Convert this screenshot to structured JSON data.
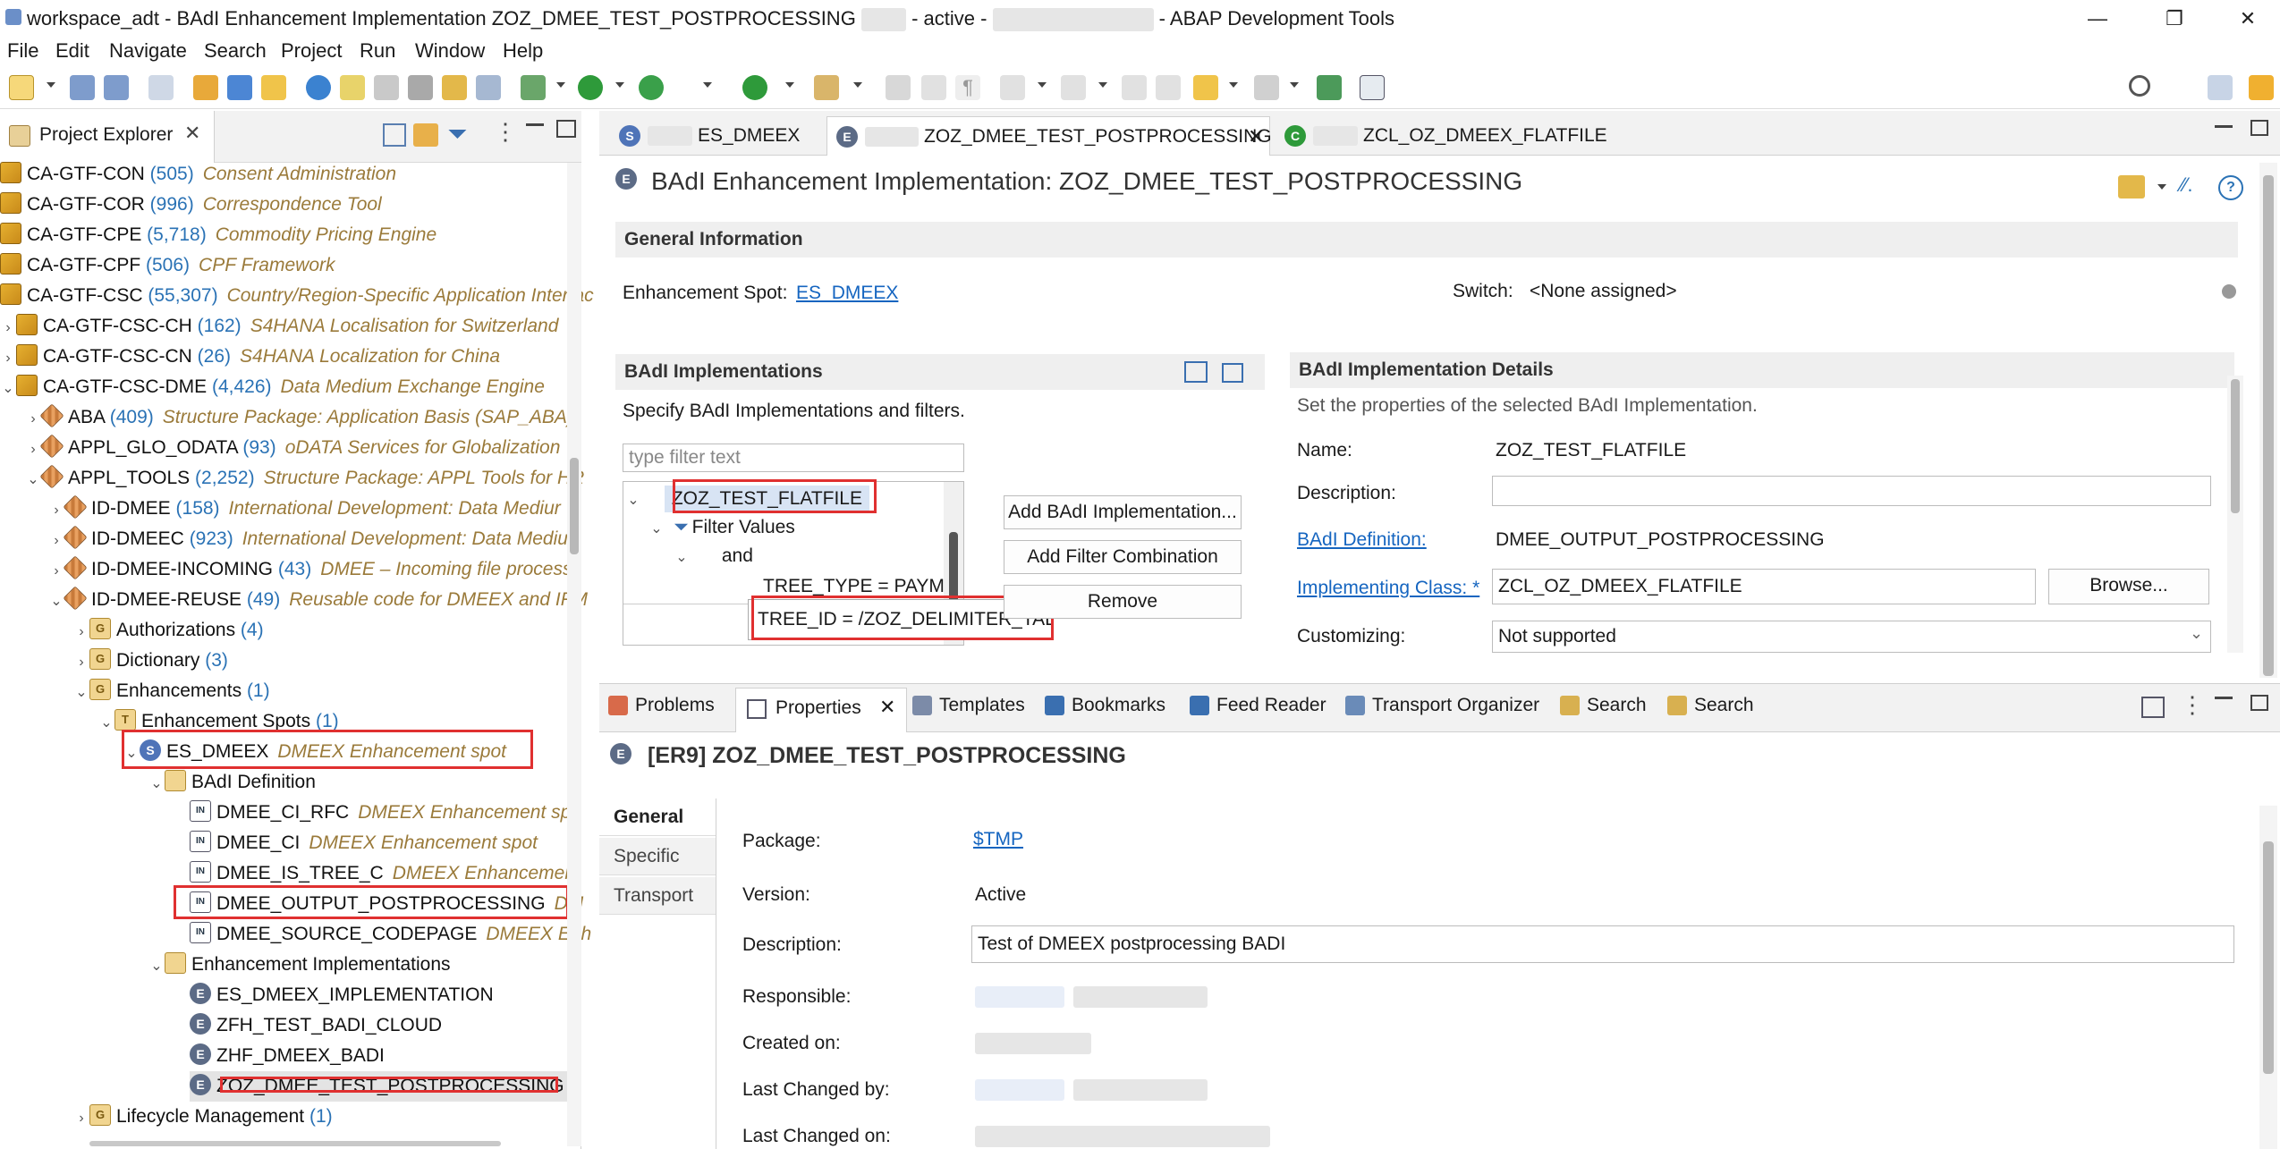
{
  "window": {
    "title_prefix": "workspace_adt - BAdI Enhancement Implementation ZOZ_DMEE_TEST_POSTPROCESSING",
    "title_status": "- active -",
    "title_app": "- ABAP Development Tools",
    "minimize": "—",
    "restore": "❐",
    "close": "✕"
  },
  "menu": [
    "File",
    "Edit",
    "Navigate",
    "Search",
    "Project",
    "Run",
    "Window",
    "Help"
  ],
  "project_explorer": {
    "tab_label": "Project Explorer",
    "rows": [
      {
        "name": "CA-GTF-CON",
        "count": "(505)",
        "desc": "Consent Administration"
      },
      {
        "name": "CA-GTF-COR",
        "count": "(996)",
        "desc": "Correspondence Tool"
      },
      {
        "name": "CA-GTF-CPE",
        "count": "(5,718)",
        "desc": "Commodity Pricing Engine"
      },
      {
        "name": "CA-GTF-CPF",
        "count": "(506)",
        "desc": "CPF Framework"
      },
      {
        "name": "CA-GTF-CSC",
        "count": "(55,307)",
        "desc": "Country/Region-Specific Application Interfac"
      },
      {
        "name": "CA-GTF-CSC-CH",
        "count": "(162)",
        "desc": "S4HANA Localisation for Switzerland"
      },
      {
        "name": "CA-GTF-CSC-CN",
        "count": "(26)",
        "desc": "S4HANA Localization for China"
      },
      {
        "name": "CA-GTF-CSC-DME",
        "count": "(4,426)",
        "desc": "Data Medium Exchange Engine"
      },
      {
        "name": "ABA",
        "count": "(409)",
        "desc": "Structure Package: Application Basis (SAP_ABA)"
      },
      {
        "name": "APPL_GLO_ODATA",
        "count": "(93)",
        "desc": "oDATA Services for Globalization"
      },
      {
        "name": "APPL_TOOLS",
        "count": "(2,252)",
        "desc": "Structure Package: APPL Tools for HR"
      },
      {
        "name": "ID-DMEE",
        "count": "(158)",
        "desc": "International Development: Data Mediur"
      },
      {
        "name": "ID-DMEEC",
        "count": "(923)",
        "desc": "International Development: Data Mediu"
      },
      {
        "name": "ID-DMEE-INCOMING",
        "count": "(43)",
        "desc": "DMEE – Incoming file process"
      },
      {
        "name": "ID-DMEE-REUSE",
        "count": "(49)",
        "desc": "Reusable code for DMEEX and IFM"
      },
      {
        "name": "Authorizations",
        "count": "(4)",
        "desc": ""
      },
      {
        "name": "Dictionary",
        "count": "(3)",
        "desc": ""
      },
      {
        "name": "Enhancements",
        "count": "(1)",
        "desc": ""
      },
      {
        "name": "Enhancement Spots",
        "count": "(1)",
        "desc": ""
      },
      {
        "name": "ES_DMEEX",
        "count": "",
        "desc": "DMEEX Enhancement spot"
      },
      {
        "name": "BAdI Definition",
        "count": "",
        "desc": ""
      },
      {
        "name": "DMEE_CI_RFC",
        "count": "",
        "desc": "DMEEX Enhancement spo"
      },
      {
        "name": "DMEE_CI",
        "count": "",
        "desc": "DMEEX Enhancement spot"
      },
      {
        "name": "DMEE_IS_TREE_C",
        "count": "",
        "desc": "DMEEX Enhancement"
      },
      {
        "name": "DMEE_OUTPUT_POSTPROCESSING",
        "count": "",
        "desc": "DM"
      },
      {
        "name": "DMEE_SOURCE_CODEPAGE",
        "count": "",
        "desc": "DMEEX Enh"
      },
      {
        "name": "Enhancement Implementations",
        "count": "",
        "desc": ""
      },
      {
        "name": "ES_DMEEX_IMPLEMENTATION",
        "count": "",
        "desc": ""
      },
      {
        "name": "ZFH_TEST_BADI_CLOUD",
        "count": "",
        "desc": ""
      },
      {
        "name": "ZHF_DMEEX_BADI",
        "count": "",
        "desc": ""
      },
      {
        "name": "ZOZ_DMEE_TEST_POSTPROCESSING",
        "count": "",
        "desc": ""
      },
      {
        "name": "Lifecycle Management",
        "count": "(1)",
        "desc": ""
      }
    ]
  },
  "editor": {
    "tabs": [
      {
        "label": "ES_DMEEX",
        "icon": "S"
      },
      {
        "label": "ZOZ_DMEE_TEST_POSTPROCESSING",
        "icon": "E"
      },
      {
        "label": "ZCL_OZ_DMEEX_FLATFILE",
        "icon": "C"
      }
    ],
    "title": "BAdI Enhancement Implementation: ZOZ_DMEE_TEST_POSTPROCESSING",
    "general_info": "General Information",
    "enh_spot_label": "Enhancement Spot:",
    "enh_spot_value": "ES_DMEEX",
    "switch_label": "Switch:",
    "switch_value": "<None assigned>",
    "impls_header": "BAdI Implementations",
    "impls_desc": "Specify BAdI Implementations and filters.",
    "filter_placeholder": "type filter text",
    "tree": {
      "impl": "ZOZ_TEST_FLATFILE",
      "filter_values": "Filter Values",
      "and": "and",
      "tree_type": "TREE_TYPE = PAYM",
      "tree_id": "TREE_ID = /ZOZ_DELIMITER_TAB"
    },
    "buttons": {
      "add_impl": "Add BAdI Implementation...",
      "add_filter": "Add Filter Combination",
      "remove": "Remove",
      "browse": "Browse..."
    },
    "details": {
      "header": "BAdI Implementation Details",
      "desc": "Set the properties of the selected BAdI Implementation.",
      "name_label": "Name:",
      "name_value": "ZOZ_TEST_FLATFILE",
      "description_label": "Description:",
      "description_value": "",
      "badi_def_label": "BAdI Definition:",
      "badi_def_value": "DMEE_OUTPUT_POSTPROCESSING",
      "impl_class_label": "Implementing Class: *",
      "impl_class_value": "ZCL_OZ_DMEEX_FLATFILE",
      "customizing_label": "Customizing:",
      "customizing_value": "Not supported"
    }
  },
  "bottom": {
    "tabs": [
      "Problems",
      "Properties",
      "Templates",
      "Bookmarks",
      "Feed Reader",
      "Transport Organizer",
      "Search",
      "Search"
    ],
    "title": "[ER9] ZOZ_DMEE_TEST_POSTPROCESSING",
    "vtabs": [
      "General",
      "Specific",
      "Transport"
    ],
    "package_label": "Package:",
    "package_value": "$TMP",
    "version_label": "Version:",
    "version_value": "Active",
    "description_label": "Description:",
    "description_value": "Test of DMEEX postprocessing BADI",
    "responsible_label": "Responsible:",
    "created_on_label": "Created on:",
    "last_changed_by_label": "Last Changed by:",
    "last_changed_on_label": "Last Changed on:"
  },
  "colors": {
    "link": "#1565c0",
    "highlight_box": "#e03030",
    "count": "#2a72b5",
    "desc": "#9a7a3a"
  }
}
